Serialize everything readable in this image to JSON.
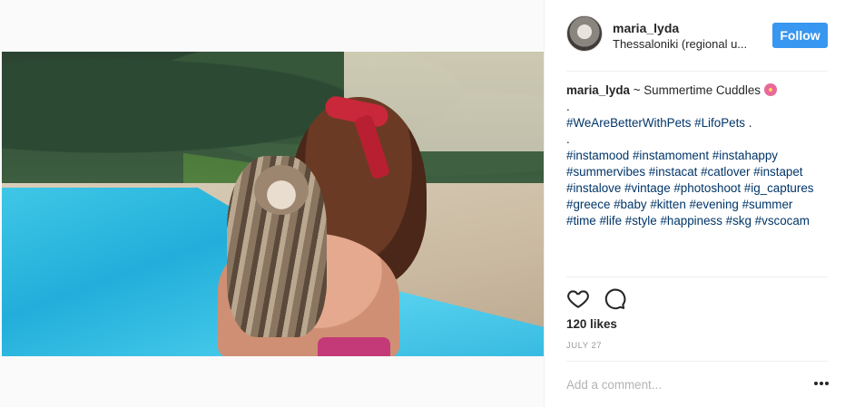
{
  "post": {
    "username": "maria_lyda",
    "location": "Thessaloniki (regional u...",
    "follow_label": "Follow",
    "caption": {
      "username": "maria_lyda",
      "text": " ~ Summertime Cuddles",
      "emoji_icon": "hibiscus-flower-icon",
      "lines": [
        ".",
        "#WeAreBetterWithPets #LifoPets .",
        ".",
        "#instamood #instamoment #instahappy",
        "#summervibes #instacat #catlover #instapet",
        "#instalove #vintage #photoshoot #ig_captures",
        "#greece #baby #kitten #evening #summer",
        "#time #life #style #happiness #skg #vscocam"
      ]
    },
    "likes": "120 likes",
    "date": "JULY 27",
    "comment_placeholder": "Add a comment...",
    "more_label": "•••",
    "icons": [
      "heart-outline-icon",
      "comment-outline-icon"
    ]
  },
  "colors": {
    "follow_button": "#3897f0",
    "hashtag": "#003569",
    "muted": "#999999"
  }
}
